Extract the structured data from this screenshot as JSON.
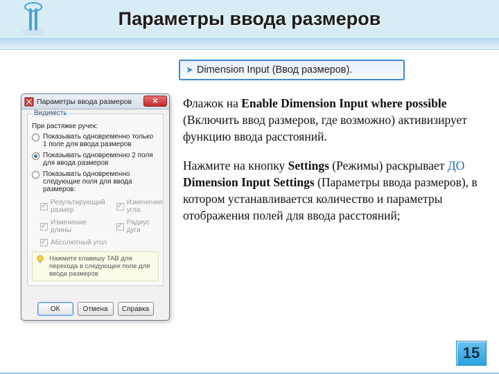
{
  "title": "Параметры ввода размеров",
  "callout": {
    "text": "Dimension Input (Ввод размеров)."
  },
  "paragraph1": {
    "p1a": "Флажок на ",
    "p1b_bold": "Enable Dimension Input where possible",
    "p1c": " (Включить ввод размеров, где возможно) активизирует функцию ввода расстояний."
  },
  "paragraph2": {
    "p2a": "Нажмите на кнопку ",
    "p2b_bold": "Settings",
    "p2c": " (Режимы) раскрывает ",
    "p2d_do": "ДО",
    "p2e_bold": " Dimension Input Settings",
    "p2f": " (Параметры ввода размеров), в котором устанавливается количество и параметры отображения полей для ввода расстояний;"
  },
  "dialog": {
    "title": "Параметры ввода размеров",
    "group_label": "Видимість",
    "sub_label": "При растяжке ручек:",
    "radio1": "Показывать одновременно только 1 поле для ввода размеров",
    "radio2": "Показывать одновременно 2 поля для ввода размеров",
    "radio3": "Показывать одновременно следующие поля для ввода размеров:",
    "cb1": "Результирующий размер",
    "cb2": "Изменение угла",
    "cb3": "Изменение длины",
    "cb4": "Радиус дуги",
    "cb5": "Абсолютный угол",
    "hint": "Нажмите клавишу TAB для перехода в следующее поле для ввода размеров",
    "buttons": {
      "ok": "ОК",
      "cancel": "Отмена",
      "help": "Справка"
    }
  },
  "page_number": "15"
}
